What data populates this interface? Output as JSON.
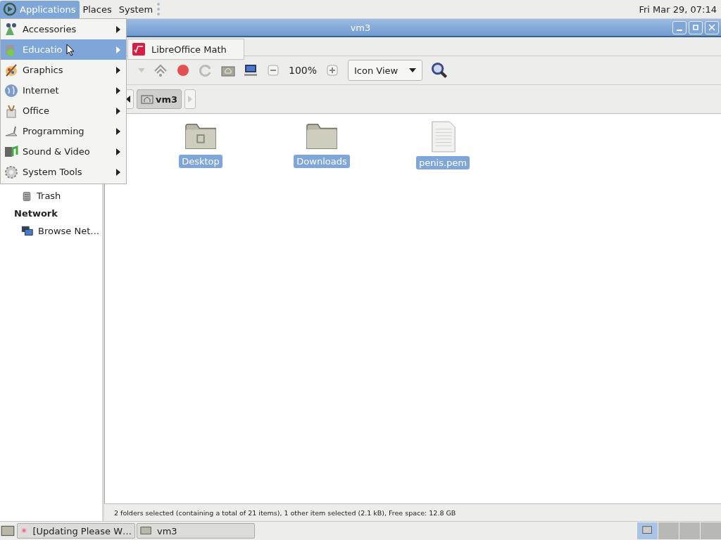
{
  "top_panel": {
    "menus": [
      {
        "label": "Applications",
        "selected": true
      },
      {
        "label": "Places",
        "selected": false
      },
      {
        "label": "System",
        "selected": false
      }
    ],
    "clock": "Fri Mar 29, 07:14"
  },
  "window": {
    "title": "vm3"
  },
  "toolbar": {
    "zoom": "100%",
    "view": "Icon View"
  },
  "location": {
    "path": [
      {
        "label": "vm3",
        "selected": true
      }
    ]
  },
  "sidebar": {
    "items": [
      {
        "kind": "item",
        "label": "Trash"
      },
      {
        "kind": "header",
        "label": "Network"
      },
      {
        "kind": "item",
        "label": "Browse Net…"
      }
    ]
  },
  "files": [
    {
      "name": "Desktop",
      "kind": "desktop",
      "selected": true
    },
    {
      "name": "Downloads",
      "kind": "folder",
      "selected": true
    },
    {
      "name": "penis.pem",
      "kind": "file",
      "selected": true
    }
  ],
  "status_bar": "2 folders selected (containing a total of 21 items), 1 other item selected (2.1 kB), Free space: 12.8 GB",
  "taskbar": {
    "tasks": [
      {
        "label": "[Updating Please W…",
        "selected": false
      },
      {
        "label": "vm3",
        "selected": false
      }
    ],
    "workspaces": [
      {
        "selected": true
      },
      {
        "selected": false
      },
      {
        "selected": false
      },
      {
        "selected": false
      }
    ]
  },
  "applications_menu": {
    "items": [
      {
        "label": "Accessories",
        "selected": false
      },
      {
        "label": "Educatio",
        "selected": true
      },
      {
        "label": "Graphics",
        "selected": false
      },
      {
        "label": "Internet",
        "selected": false
      },
      {
        "label": "Office",
        "selected": false
      },
      {
        "label": "Programming",
        "selected": false
      },
      {
        "label": "Sound & Video",
        "selected": false
      },
      {
        "label": "System Tools",
        "selected": false
      }
    ]
  },
  "submenu": {
    "items": [
      {
        "label": "LibreOffice Math"
      }
    ]
  }
}
